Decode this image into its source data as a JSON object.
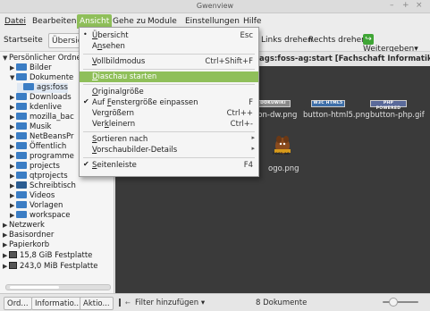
{
  "window": {
    "title": "Gwenview",
    "controls": [
      "–",
      "+",
      "×"
    ]
  },
  "menubar": [
    {
      "label": "Datei",
      "active": false
    },
    {
      "label": "Bearbeiten",
      "active": false
    },
    {
      "label": "Ansicht",
      "active": true
    },
    {
      "label": "Gehe zu",
      "active": false
    },
    {
      "label": "Module",
      "active": false
    },
    {
      "label": "Einstellungen",
      "active": false
    },
    {
      "label": "Hilfe",
      "active": false
    }
  ],
  "toolbar": {
    "startseite": "Startseite",
    "uebersicht": "Übersich",
    "rotate_left": "Links drehen",
    "rotate_right": "Rechts drehen",
    "share": "Weitergeben",
    "share_arrow": "▾"
  },
  "sidebar": {
    "tree": [
      {
        "label": "Persönlicher Ordne",
        "arrow": "▼",
        "indent": 0,
        "icon": "none"
      },
      {
        "label": "Bilder",
        "arrow": "▶",
        "indent": 1,
        "icon": "folder"
      },
      {
        "label": "Dokumente",
        "arrow": "▼",
        "indent": 1,
        "icon": "folder"
      },
      {
        "label": "ags:foss",
        "arrow": "",
        "indent": 2,
        "icon": "folder"
      },
      {
        "label": "Downloads",
        "arrow": "▶",
        "indent": 1,
        "icon": "folder"
      },
      {
        "label": "kdenlive",
        "arrow": "▶",
        "indent": 1,
        "icon": "folder"
      },
      {
        "label": "mozilla_bac",
        "arrow": "▶",
        "indent": 1,
        "icon": "folder"
      },
      {
        "label": "Musik",
        "arrow": "▶",
        "indent": 1,
        "icon": "folder"
      },
      {
        "label": "NetBeansPr",
        "arrow": "▶",
        "indent": 1,
        "icon": "folder"
      },
      {
        "label": "Öffentlich",
        "arrow": "▶",
        "indent": 1,
        "icon": "folder"
      },
      {
        "label": "programme",
        "arrow": "▶",
        "indent": 1,
        "icon": "folder"
      },
      {
        "label": "projects",
        "arrow": "▶",
        "indent": 1,
        "icon": "folder"
      },
      {
        "label": "qtprojects",
        "arrow": "▶",
        "indent": 1,
        "icon": "folder"
      },
      {
        "label": "Schreibtisch",
        "arrow": "▶",
        "indent": 1,
        "icon": "folder-dark"
      },
      {
        "label": "Videos",
        "arrow": "▶",
        "indent": 1,
        "icon": "folder"
      },
      {
        "label": "Vorlagen",
        "arrow": "▶",
        "indent": 1,
        "icon": "folder"
      },
      {
        "label": "workspace",
        "arrow": "▶",
        "indent": 1,
        "icon": "folder"
      },
      {
        "label": "Netzwerk",
        "arrow": "▶",
        "indent": 0,
        "icon": "none"
      },
      {
        "label": "Basisordner",
        "arrow": "▶",
        "indent": 0,
        "icon": "none"
      },
      {
        "label": "Papierkorb",
        "arrow": "▶",
        "indent": 0,
        "icon": "none"
      },
      {
        "label": "15,8 GiB Festplatte",
        "arrow": "▶",
        "indent": 0,
        "icon": "drive"
      },
      {
        "label": "243,0 MiB Festplatte",
        "arrow": "▶",
        "indent": 0,
        "icon": "drive"
      }
    ]
  },
  "content": {
    "header": "ags:foss-ag:start [Fachschaft Informatik]-Dateien",
    "thumbnails": [
      {
        "badge": "DOKUWIKI",
        "label": "ton-dw.png"
      },
      {
        "badge": "W3C HTML5",
        "label": "button-html5.png"
      },
      {
        "badge": "PHP POWERED",
        "label": "button-php.gif"
      }
    ],
    "logo_label": "ogo.png",
    "logo_word": "FOSS-AG"
  },
  "menu": {
    "items": [
      {
        "type": "item",
        "check": "•",
        "label": "Übersicht",
        "ul": 0,
        "shortcut": "Esc",
        "sub": false,
        "highlight": false
      },
      {
        "type": "item",
        "check": "",
        "label": "Ansehen",
        "ul": 1,
        "shortcut": "",
        "sub": false,
        "highlight": false
      },
      {
        "type": "sep"
      },
      {
        "type": "item",
        "check": "",
        "label": "Vollbildmodus",
        "ul": 0,
        "shortcut": "Ctrl+Shift+F",
        "sub": false,
        "highlight": false
      },
      {
        "type": "sep"
      },
      {
        "type": "item",
        "check": "",
        "label": "Diaschau starten",
        "ul": 0,
        "shortcut": "",
        "sub": false,
        "highlight": true
      },
      {
        "type": "sep"
      },
      {
        "type": "item",
        "check": "",
        "label": "Originalgröße",
        "ul": 0,
        "shortcut": "",
        "sub": false,
        "highlight": false
      },
      {
        "type": "item",
        "check": "✔",
        "label": "Auf Fenstergröße einpassen",
        "ul": 4,
        "shortcut": "F",
        "sub": false,
        "highlight": false
      },
      {
        "type": "item",
        "check": "",
        "label": "Vergrößern",
        "ul": 3,
        "shortcut": "Ctrl++",
        "sub": false,
        "highlight": false
      },
      {
        "type": "item",
        "check": "",
        "label": "Verkleinern",
        "ul": 3,
        "shortcut": "Ctrl+-",
        "sub": false,
        "highlight": false
      },
      {
        "type": "sep"
      },
      {
        "type": "item",
        "check": "",
        "label": "Sortieren nach",
        "ul": 0,
        "shortcut": "",
        "sub": true,
        "highlight": false
      },
      {
        "type": "item",
        "check": "",
        "label": "Vorschaubilder-Details",
        "ul": 0,
        "shortcut": "",
        "sub": true,
        "highlight": false
      },
      {
        "type": "sep"
      },
      {
        "type": "item",
        "check": "✔",
        "label": "Seitenleiste",
        "ul": 0,
        "shortcut": "F4",
        "sub": false,
        "highlight": false
      }
    ]
  },
  "statusbar": {
    "tabs": [
      "Ord...",
      "Informatio...",
      "Aktio..."
    ],
    "filter": "Filter hinzufügen",
    "filter_arrow": "▾",
    "count": "8 Dokumente",
    "zoom_level": 0.3
  },
  "colors": {
    "accent": "#8fbf5a",
    "folder": "#3b7dc4"
  }
}
